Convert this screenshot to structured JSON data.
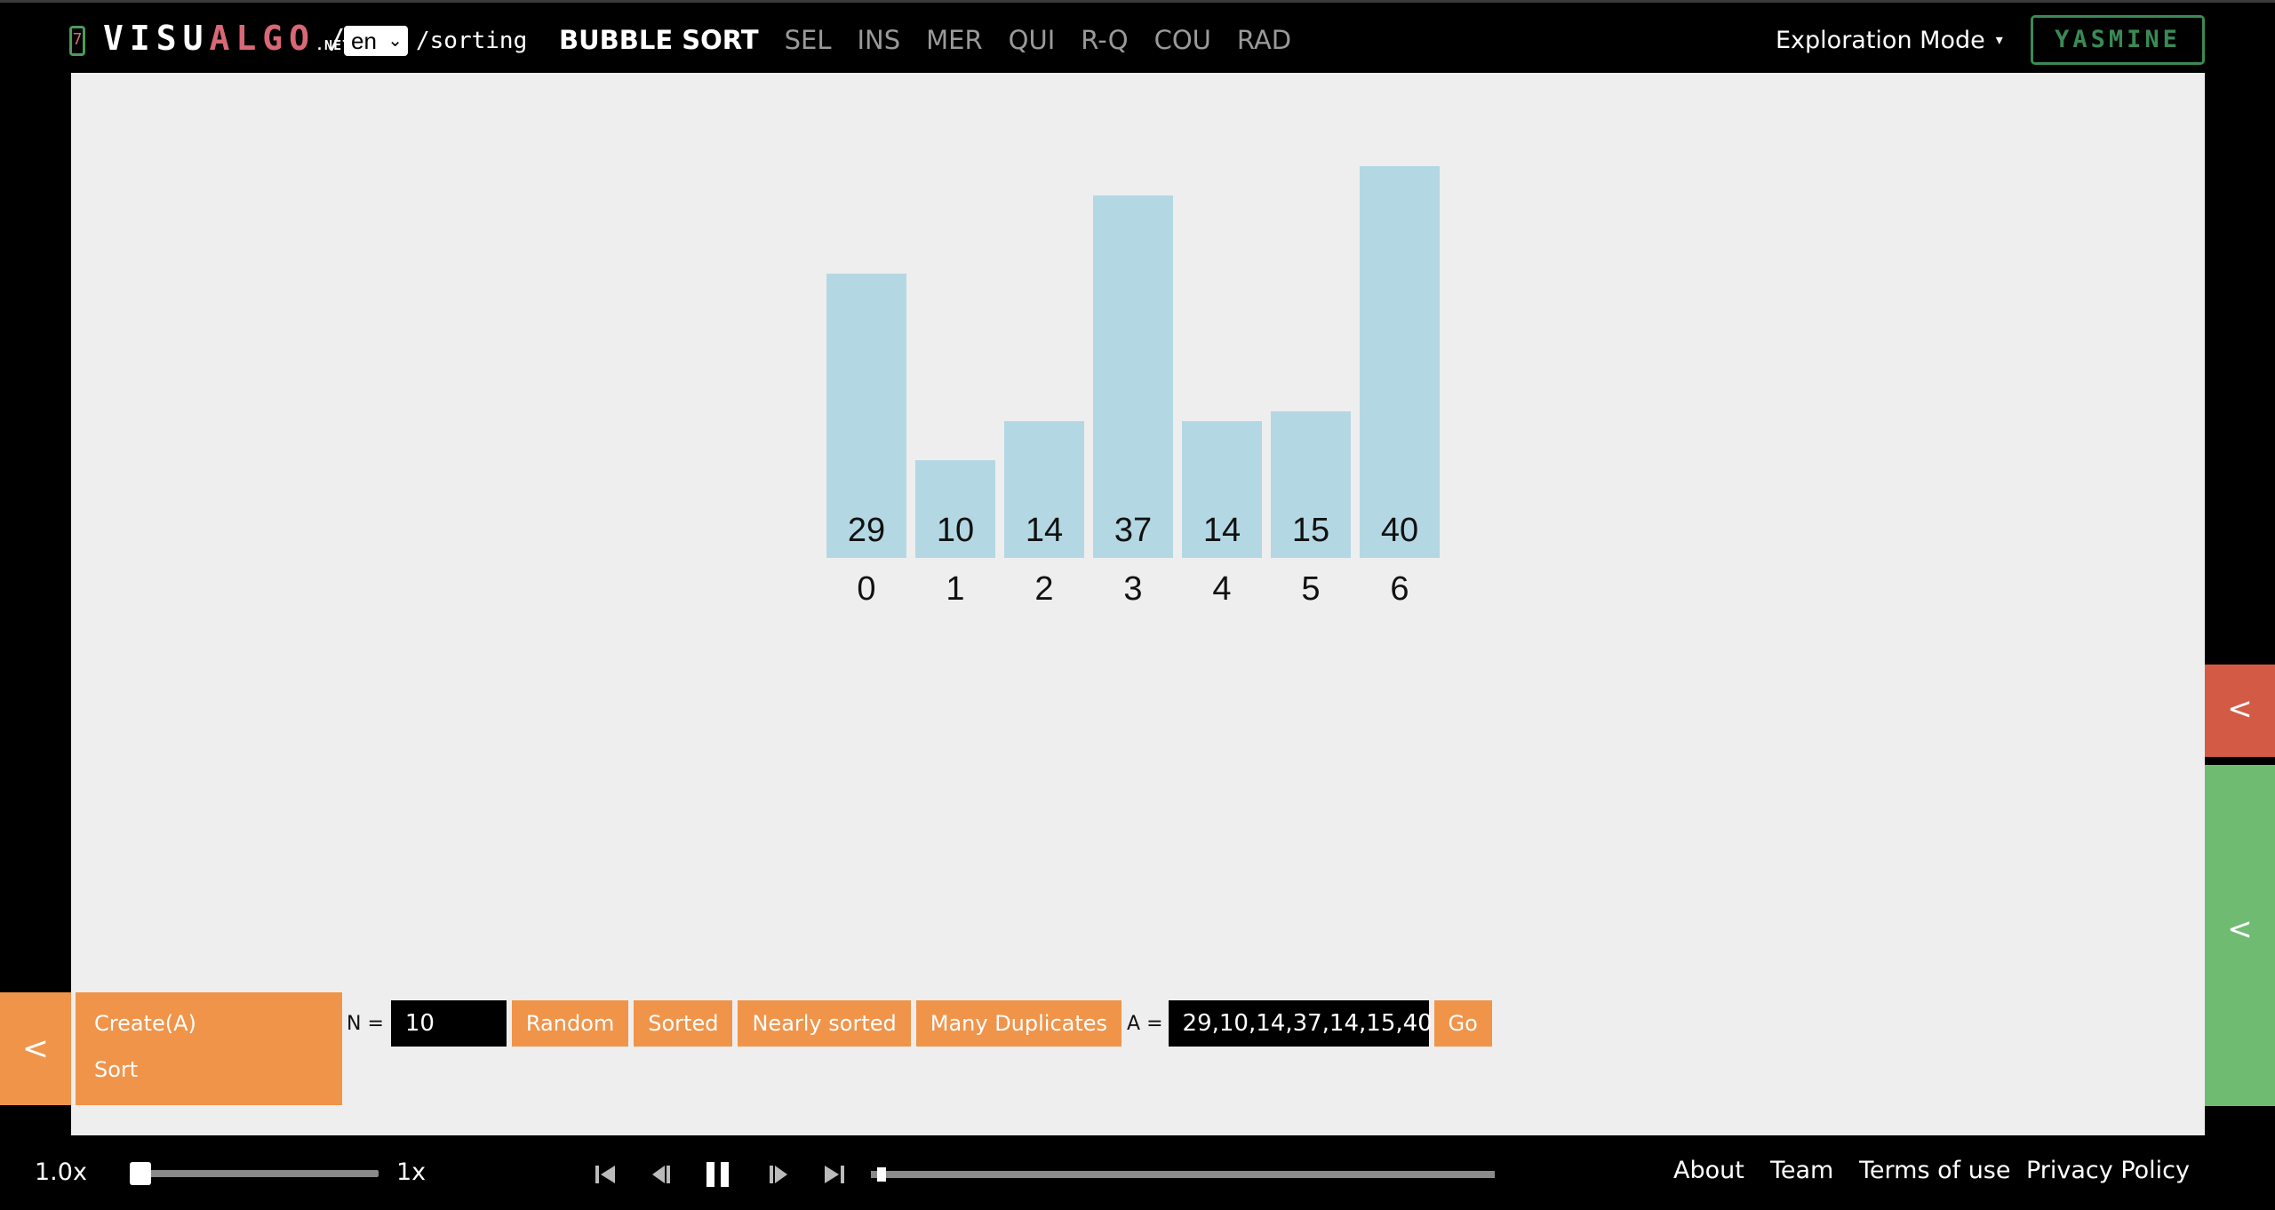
{
  "header": {
    "logo_mark": "7",
    "logo_white": "VISU",
    "logo_red": "ALGO",
    "logo_net": ".NET",
    "logo_slash": "/",
    "lang": "en",
    "path": "/sorting",
    "algo_tabs": [
      {
        "label": "BUBBLE SORT",
        "active": true
      },
      {
        "label": "SEL",
        "active": false
      },
      {
        "label": "INS",
        "active": false
      },
      {
        "label": "MER",
        "active": false
      },
      {
        "label": "QUI",
        "active": false
      },
      {
        "label": "R-Q",
        "active": false
      },
      {
        "label": "COU",
        "active": false
      },
      {
        "label": "RAD",
        "active": false
      }
    ],
    "mode_label": "Exploration Mode",
    "mode_caret": "▾",
    "user": "YASMINE"
  },
  "chart_data": {
    "type": "bar",
    "categories": [
      "0",
      "1",
      "2",
      "3",
      "4",
      "5",
      "6"
    ],
    "values": [
      29,
      10,
      14,
      37,
      14,
      15,
      40
    ],
    "bar_color": "#b4d8e3"
  },
  "action_panel": {
    "toggle": "<",
    "items": [
      "Create(A)",
      "Sort"
    ],
    "n_label": "N =",
    "n_value": "10",
    "buttons": [
      "Random",
      "Sorted",
      "Nearly sorted",
      "Many Duplicates"
    ],
    "a_label": "A =",
    "a_value": "29,10,14,37,14,15,40",
    "go": "Go"
  },
  "side_panels": {
    "red_chevron": "<",
    "green_chevron": "<"
  },
  "playback": {
    "speed_value": "1.0x",
    "speed_label": "1x",
    "speed_fraction": 0.0,
    "progress_fraction": 0.01,
    "controls": [
      "skip-to-start-icon",
      "step-back-icon",
      "pause-icon",
      "step-forward-icon",
      "skip-to-end-icon"
    ]
  },
  "footer": {
    "links": [
      "About",
      "Team",
      "Terms of use",
      "Privacy Policy"
    ]
  },
  "colors": {
    "accent_orange": "#f0944a",
    "side_red": "#d35b45",
    "side_green": "#6fbb72",
    "logo_red": "#d96876",
    "user_green": "#3a8a55"
  }
}
